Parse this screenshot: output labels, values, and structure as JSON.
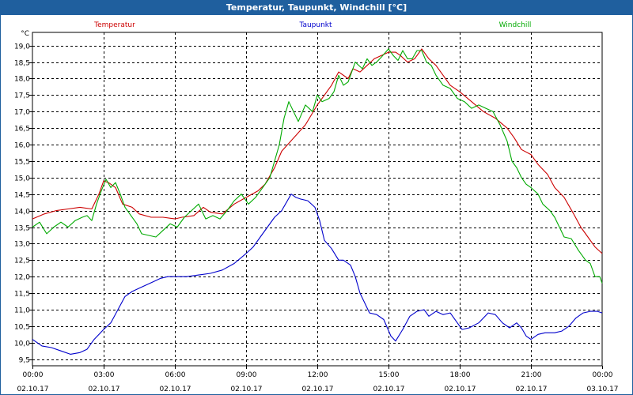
{
  "window": {
    "title": "Temperatur, Taupunkt, Windchill [°C]"
  },
  "colors": {
    "titlebar": "#1f5f9e",
    "temperatur": "#cc0000",
    "taupunkt": "#0000cc",
    "windchill": "#00aa00",
    "grid": "#000000"
  },
  "chart_data": {
    "type": "line",
    "title": "Temperatur, Taupunkt, Windchill [°C]",
    "ylabel": "°C",
    "ylim": [
      9.3,
      19.4
    ],
    "yticks": [
      "9,5",
      "10,0",
      "10,5",
      "11,0",
      "11,5",
      "12,0",
      "12,5",
      "13,0",
      "13,5",
      "14,0",
      "14,5",
      "15,0",
      "15,5",
      "16,0",
      "16,5",
      "17,0",
      "17,5",
      "18,0",
      "18,5",
      "19,0"
    ],
    "xlim": [
      0,
      24
    ],
    "xticks": [
      {
        "time": "00:00",
        "date": "02.10.17"
      },
      {
        "time": "03:00",
        "date": "02.10.17"
      },
      {
        "time": "06:00",
        "date": "02.10.17"
      },
      {
        "time": "09:00",
        "date": "02.10.17"
      },
      {
        "time": "12:00",
        "date": "02.10.17"
      },
      {
        "time": "15:00",
        "date": "02.10.17"
      },
      {
        "time": "18:00",
        "date": "02.10.17"
      },
      {
        "time": "21:00",
        "date": "02.10.17"
      },
      {
        "time": "00:00",
        "date": "03.10.17"
      }
    ],
    "grid": true,
    "legend_position": "top",
    "series": [
      {
        "name": "Temperatur",
        "color": "#cc0000",
        "points": [
          [
            0,
            13.75
          ],
          [
            0.5,
            13.9
          ],
          [
            1,
            14.0
          ],
          [
            1.5,
            14.05
          ],
          [
            2,
            14.1
          ],
          [
            2.5,
            14.05
          ],
          [
            2.8,
            14.5
          ],
          [
            3,
            14.9
          ],
          [
            3.2,
            14.85
          ],
          [
            3.5,
            14.7
          ],
          [
            3.8,
            14.2
          ],
          [
            4.2,
            14.1
          ],
          [
            4.5,
            13.9
          ],
          [
            5,
            13.8
          ],
          [
            5.5,
            13.8
          ],
          [
            6,
            13.75
          ],
          [
            6.3,
            13.8
          ],
          [
            6.8,
            13.85
          ],
          [
            7.2,
            14.1
          ],
          [
            7.5,
            13.95
          ],
          [
            8,
            13.9
          ],
          [
            8.5,
            14.2
          ],
          [
            9,
            14.4
          ],
          [
            9.5,
            14.6
          ],
          [
            9.8,
            14.8
          ],
          [
            10.2,
            15.3
          ],
          [
            10.5,
            15.8
          ],
          [
            11,
            16.2
          ],
          [
            11.5,
            16.6
          ],
          [
            12,
            17.2
          ],
          [
            12.3,
            17.5
          ],
          [
            12.6,
            17.8
          ],
          [
            12.9,
            18.2
          ],
          [
            13.3,
            18.0
          ],
          [
            13.5,
            18.3
          ],
          [
            13.8,
            18.2
          ],
          [
            14.1,
            18.4
          ],
          [
            14.4,
            18.6
          ],
          [
            14.7,
            18.7
          ],
          [
            15,
            18.8
          ],
          [
            15.3,
            18.8
          ],
          [
            15.5,
            18.7
          ],
          [
            15.8,
            18.5
          ],
          [
            16.1,
            18.6
          ],
          [
            16.4,
            18.9
          ],
          [
            16.7,
            18.6
          ],
          [
            17,
            18.4
          ],
          [
            17.3,
            18.1
          ],
          [
            17.6,
            17.8
          ],
          [
            18,
            17.6
          ],
          [
            18.5,
            17.3
          ],
          [
            19,
            17.0
          ],
          [
            19.5,
            16.8
          ],
          [
            20,
            16.5
          ],
          [
            20.3,
            16.2
          ],
          [
            20.6,
            15.85
          ],
          [
            21,
            15.7
          ],
          [
            21.3,
            15.4
          ],
          [
            21.7,
            15.1
          ],
          [
            22,
            14.7
          ],
          [
            22.4,
            14.4
          ],
          [
            22.8,
            13.9
          ],
          [
            23.1,
            13.5
          ],
          [
            23.4,
            13.2
          ],
          [
            23.7,
            12.9
          ],
          [
            24,
            12.7
          ]
        ]
      },
      {
        "name": "Taupunkt",
        "color": "#0000cc",
        "points": [
          [
            0,
            10.1
          ],
          [
            0.4,
            9.9
          ],
          [
            0.8,
            9.85
          ],
          [
            1.2,
            9.75
          ],
          [
            1.6,
            9.65
          ],
          [
            2,
            9.7
          ],
          [
            2.3,
            9.8
          ],
          [
            2.6,
            10.1
          ],
          [
            3,
            10.4
          ],
          [
            3.3,
            10.6
          ],
          [
            3.6,
            11.0
          ],
          [
            3.9,
            11.4
          ],
          [
            4.2,
            11.55
          ],
          [
            4.5,
            11.65
          ],
          [
            4.8,
            11.75
          ],
          [
            5.1,
            11.85
          ],
          [
            5.4,
            11.95
          ],
          [
            5.7,
            12.0
          ],
          [
            6,
            12.0
          ],
          [
            6.5,
            12.0
          ],
          [
            7,
            12.05
          ],
          [
            7.5,
            12.1
          ],
          [
            8,
            12.2
          ],
          [
            8.5,
            12.4
          ],
          [
            9,
            12.7
          ],
          [
            9.3,
            12.9
          ],
          [
            9.6,
            13.2
          ],
          [
            9.9,
            13.5
          ],
          [
            10.2,
            13.8
          ],
          [
            10.5,
            14.0
          ],
          [
            10.7,
            14.25
          ],
          [
            10.9,
            14.5
          ],
          [
            11.1,
            14.4
          ],
          [
            11.3,
            14.35
          ],
          [
            11.6,
            14.3
          ],
          [
            11.9,
            14.1
          ],
          [
            12.1,
            13.7
          ],
          [
            12.3,
            13.1
          ],
          [
            12.6,
            12.85
          ],
          [
            12.9,
            12.5
          ],
          [
            13.1,
            12.5
          ],
          [
            13.4,
            12.35
          ],
          [
            13.6,
            12.0
          ],
          [
            13.8,
            11.5
          ],
          [
            14,
            11.2
          ],
          [
            14.2,
            10.9
          ],
          [
            14.5,
            10.85
          ],
          [
            14.8,
            10.7
          ],
          [
            15.1,
            10.2
          ],
          [
            15.3,
            10.05
          ],
          [
            15.6,
            10.4
          ],
          [
            15.9,
            10.8
          ],
          [
            16.2,
            10.95
          ],
          [
            16.5,
            11.0
          ],
          [
            16.7,
            10.8
          ],
          [
            17,
            10.95
          ],
          [
            17.3,
            10.85
          ],
          [
            17.6,
            10.9
          ],
          [
            17.9,
            10.6
          ],
          [
            18.1,
            10.4
          ],
          [
            18.4,
            10.45
          ],
          [
            18.8,
            10.6
          ],
          [
            19.2,
            10.9
          ],
          [
            19.5,
            10.85
          ],
          [
            19.8,
            10.6
          ],
          [
            20.1,
            10.45
          ],
          [
            20.4,
            10.6
          ],
          [
            20.6,
            10.45
          ],
          [
            20.8,
            10.2
          ],
          [
            21,
            10.1
          ],
          [
            21.3,
            10.25
          ],
          [
            21.6,
            10.3
          ],
          [
            22,
            10.3
          ],
          [
            22.3,
            10.35
          ],
          [
            22.6,
            10.5
          ],
          [
            22.9,
            10.75
          ],
          [
            23.2,
            10.9
          ],
          [
            23.5,
            10.95
          ],
          [
            23.8,
            10.95
          ],
          [
            24,
            10.9
          ]
        ]
      },
      {
        "name": "Windchill",
        "color": "#00aa00",
        "points": [
          [
            0,
            13.5
          ],
          [
            0.3,
            13.65
          ],
          [
            0.6,
            13.3
          ],
          [
            0.9,
            13.5
          ],
          [
            1.2,
            13.65
          ],
          [
            1.5,
            13.5
          ],
          [
            1.8,
            13.7
          ],
          [
            2.1,
            13.8
          ],
          [
            2.3,
            13.85
          ],
          [
            2.5,
            13.7
          ],
          [
            2.7,
            14.2
          ],
          [
            2.9,
            14.6
          ],
          [
            3.1,
            14.95
          ],
          [
            3.3,
            14.7
          ],
          [
            3.5,
            14.85
          ],
          [
            3.7,
            14.5
          ],
          [
            3.9,
            14.1
          ],
          [
            4.1,
            13.9
          ],
          [
            4.4,
            13.6
          ],
          [
            4.6,
            13.3
          ],
          [
            4.9,
            13.25
          ],
          [
            5.2,
            13.2
          ],
          [
            5.5,
            13.4
          ],
          [
            5.8,
            13.6
          ],
          [
            6.1,
            13.5
          ],
          [
            6.4,
            13.8
          ],
          [
            6.7,
            14.0
          ],
          [
            7,
            14.2
          ],
          [
            7.3,
            13.75
          ],
          [
            7.6,
            13.85
          ],
          [
            7.9,
            13.75
          ],
          [
            8.2,
            14.0
          ],
          [
            8.5,
            14.3
          ],
          [
            8.8,
            14.5
          ],
          [
            9.1,
            14.2
          ],
          [
            9.4,
            14.4
          ],
          [
            9.7,
            14.7
          ],
          [
            10,
            15.0
          ],
          [
            10.2,
            15.5
          ],
          [
            10.4,
            16.0
          ],
          [
            10.6,
            16.8
          ],
          [
            10.8,
            17.3
          ],
          [
            11,
            17.0
          ],
          [
            11.2,
            16.7
          ],
          [
            11.5,
            17.2
          ],
          [
            11.8,
            17.0
          ],
          [
            12,
            17.5
          ],
          [
            12.2,
            17.3
          ],
          [
            12.5,
            17.4
          ],
          [
            12.7,
            17.6
          ],
          [
            12.9,
            18.1
          ],
          [
            13.1,
            17.8
          ],
          [
            13.3,
            17.9
          ],
          [
            13.6,
            18.5
          ],
          [
            13.9,
            18.3
          ],
          [
            14.1,
            18.6
          ],
          [
            14.3,
            18.4
          ],
          [
            14.5,
            18.5
          ],
          [
            14.7,
            18.65
          ],
          [
            15,
            18.9
          ],
          [
            15.2,
            18.7
          ],
          [
            15.4,
            18.55
          ],
          [
            15.6,
            18.85
          ],
          [
            15.8,
            18.6
          ],
          [
            16,
            18.6
          ],
          [
            16.2,
            18.85
          ],
          [
            16.4,
            18.85
          ],
          [
            16.6,
            18.5
          ],
          [
            16.8,
            18.4
          ],
          [
            17,
            18.1
          ],
          [
            17.3,
            17.8
          ],
          [
            17.6,
            17.7
          ],
          [
            17.9,
            17.4
          ],
          [
            18.2,
            17.3
          ],
          [
            18.5,
            17.1
          ],
          [
            18.8,
            17.2
          ],
          [
            19.1,
            17.1
          ],
          [
            19.4,
            17.0
          ],
          [
            19.7,
            16.6
          ],
          [
            20,
            16.1
          ],
          [
            20.2,
            15.5
          ],
          [
            20.4,
            15.3
          ],
          [
            20.6,
            15.0
          ],
          [
            20.8,
            14.8
          ],
          [
            21,
            14.7
          ],
          [
            21.3,
            14.5
          ],
          [
            21.5,
            14.2
          ],
          [
            21.8,
            14.0
          ],
          [
            22,
            13.8
          ],
          [
            22.2,
            13.5
          ],
          [
            22.4,
            13.2
          ],
          [
            22.7,
            13.15
          ],
          [
            23,
            12.8
          ],
          [
            23.3,
            12.5
          ],
          [
            23.5,
            12.4
          ],
          [
            23.7,
            12.0
          ],
          [
            23.9,
            12.0
          ],
          [
            24,
            11.8
          ]
        ]
      }
    ]
  }
}
